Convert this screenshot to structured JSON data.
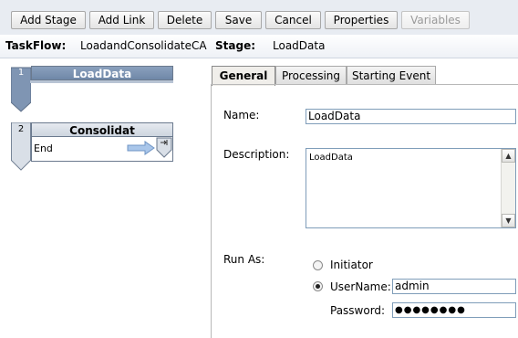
{
  "toolbar": {
    "add_stage": "Add Stage",
    "add_link": "Add Link",
    "delete": "Delete",
    "save": "Save",
    "cancel": "Cancel",
    "properties": "Properties",
    "variables": "Variables"
  },
  "header": {
    "taskflow_label": "TaskFlow:",
    "taskflow_name": "LoadandConsolidateCA",
    "stage_label": "Stage:",
    "stage_name": "LoadData"
  },
  "stages": [
    {
      "number": "1",
      "title": "LoadData",
      "selected": true
    },
    {
      "number": "2",
      "title": "Consolidat",
      "link_label": "End",
      "selected": false
    }
  ],
  "tabs": [
    {
      "label": "General",
      "active": true
    },
    {
      "label": "Processing",
      "active": false
    },
    {
      "label": "Starting Event",
      "active": false
    }
  ],
  "general": {
    "name_label": "Name:",
    "name_value": "LoadData",
    "description_label": "Description:",
    "description_value": "LoadData",
    "run_as_label": "Run As:",
    "initiator_label": "Initiator",
    "username_label": "UserName:",
    "username_value": "admin",
    "password_label": "Password:",
    "password_value": "●●●●●●●●",
    "run_as_selected": "UserName"
  },
  "icons": {
    "scroll_up": "scroll-up-arrow",
    "scroll_down": "scroll-down-arrow",
    "link_arrow": "right-arrow",
    "link_end": "link-end-marker"
  },
  "colors": {
    "stage_selected": "#7b92b2",
    "stage_default": "#d9dfe7",
    "stage_tab": "#7f95b3",
    "link_arrow": "#7aa3d8"
  }
}
